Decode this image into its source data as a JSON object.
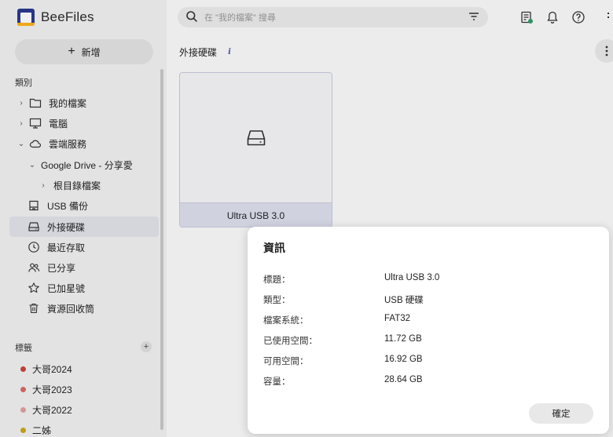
{
  "app": {
    "name": "BeeFiles"
  },
  "sidebar": {
    "new_button": "新增",
    "section_category": "類別",
    "items": [
      {
        "label": "我的檔案",
        "icon": "folder-icon"
      },
      {
        "label": "電腦",
        "icon": "computer-icon"
      },
      {
        "label": "雲端服務",
        "icon": "cloud-icon"
      },
      {
        "label": "Google Drive - 分享愛",
        "icon": ""
      },
      {
        "label": "根目錄檔案",
        "icon": ""
      },
      {
        "label": "USB 備份",
        "icon": "usb-drive-icon"
      },
      {
        "label": "外接硬碟",
        "icon": "external-drive-icon"
      },
      {
        "label": "最近存取",
        "icon": "clock-icon"
      },
      {
        "label": "已分享",
        "icon": "people-icon"
      },
      {
        "label": "已加星號",
        "icon": "star-icon"
      },
      {
        "label": "資源回收筒",
        "icon": "trash-icon"
      }
    ],
    "section_tags": "標籤",
    "tags": [
      {
        "label": "大哥2024",
        "color": "#c9443f"
      },
      {
        "label": "大哥2023",
        "color": "#d86b67"
      },
      {
        "label": "大哥2022",
        "color": "#e2a0a0"
      },
      {
        "label": "二姊",
        "color": "#c9a71e"
      }
    ]
  },
  "search": {
    "placeholder": "在 \"我的檔案\" 搜尋"
  },
  "main": {
    "breadcrumb": "外接硬碟",
    "card": {
      "label": "Ultra USB 3.0"
    }
  },
  "dialog": {
    "title": "資訊",
    "rows": [
      {
        "key": "標題：",
        "value": "Ultra USB 3.0"
      },
      {
        "key": "類型：",
        "value": "USB 硬碟"
      },
      {
        "key": "檔案系統：",
        "value": "FAT32"
      },
      {
        "key": "已使用空間：",
        "value": "11.72 GB"
      },
      {
        "key": "可用空間：",
        "value": "16.92 GB"
      },
      {
        "key": "容量：",
        "value": "28.64 GB"
      }
    ],
    "ok_button": "確定"
  }
}
